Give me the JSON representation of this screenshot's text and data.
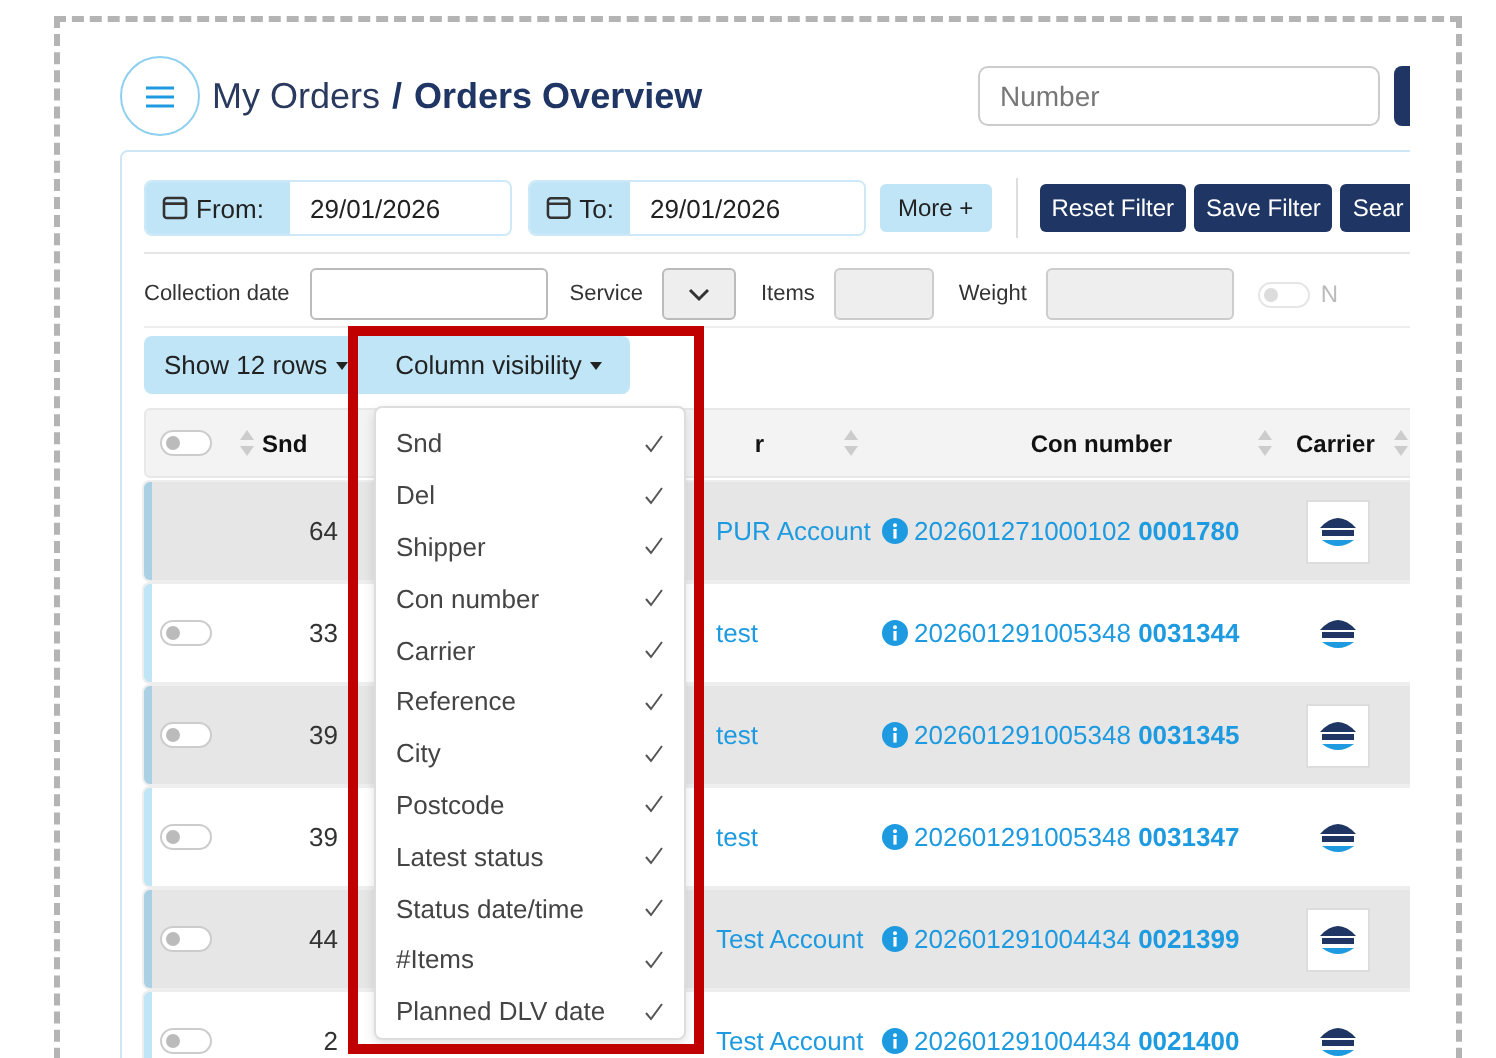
{
  "header": {
    "breadcrumb": "My Orders",
    "separator": "/",
    "title": "Orders Overview",
    "search": {
      "placeholder": "Number"
    }
  },
  "filters": {
    "from": {
      "label": "From:",
      "value": "29/01/2026"
    },
    "to": {
      "label": "To:",
      "value": "29/01/2026"
    },
    "more": "More +",
    "buttons": [
      "Reset Filter",
      "Save Filter",
      "Sear"
    ]
  },
  "fields": [
    {
      "label": "Collection date",
      "kind": "text",
      "disabled": false
    },
    {
      "label": "Service",
      "kind": "select",
      "disabled": false
    },
    {
      "label": "Items",
      "kind": "text",
      "disabled": true
    },
    {
      "label": "Weight",
      "kind": "text",
      "disabled": true
    },
    {
      "label": "N",
      "kind": "toggle",
      "disabled": true
    }
  ],
  "table_controls": {
    "show_rows": "Show 12 rows",
    "column_visibility": "Column visibility"
  },
  "table": {
    "select_all_on": false,
    "columns": [
      "Snd",
      "r",
      "Con number",
      "Carrier"
    ],
    "rows": [
      {
        "snd": "64",
        "shipper": "PUR Account",
        "con_number": "202601271000102 **0001780**"
      },
      {
        "snd": "33",
        "shipper": "test",
        "con_number": "202601291005348 **0031344**",
        "on": false
      },
      {
        "snd": "39",
        "shipper": "test",
        "con_number": "202601291005348 **0031345**",
        "on": false
      },
      {
        "snd": "39",
        "shipper": "test",
        "con_number": "202601291005348 **0031347**",
        "on": false
      },
      {
        "snd": "44",
        "shipper": "Test Account",
        "con_number": "202601291004434 **0021399**",
        "on": false
      },
      {
        "snd": "2",
        "shipper": "Test Account",
        "con_number": "202601291004434 **0021400**",
        "on": false
      }
    ]
  },
  "column_menu": {
    "items": [
      {
        "label": "Snd",
        "checked": true
      },
      {
        "label": "Del",
        "checked": true
      },
      {
        "label": "Shipper",
        "checked": true
      },
      {
        "label": "Con number",
        "checked": true
      },
      {
        "label": "Carrier",
        "checked": true
      },
      {
        "label": "Reference",
        "checked": true
      },
      {
        "label": "City",
        "checked": true
      },
      {
        "label": "Postcode",
        "checked": true
      },
      {
        "label": "Latest status",
        "checked": true
      },
      {
        "label": "Status date/time",
        "checked": true
      },
      {
        "label": "#Items",
        "checked": true
      },
      {
        "label": "Planned DLV date",
        "checked": true
      }
    ]
  }
}
